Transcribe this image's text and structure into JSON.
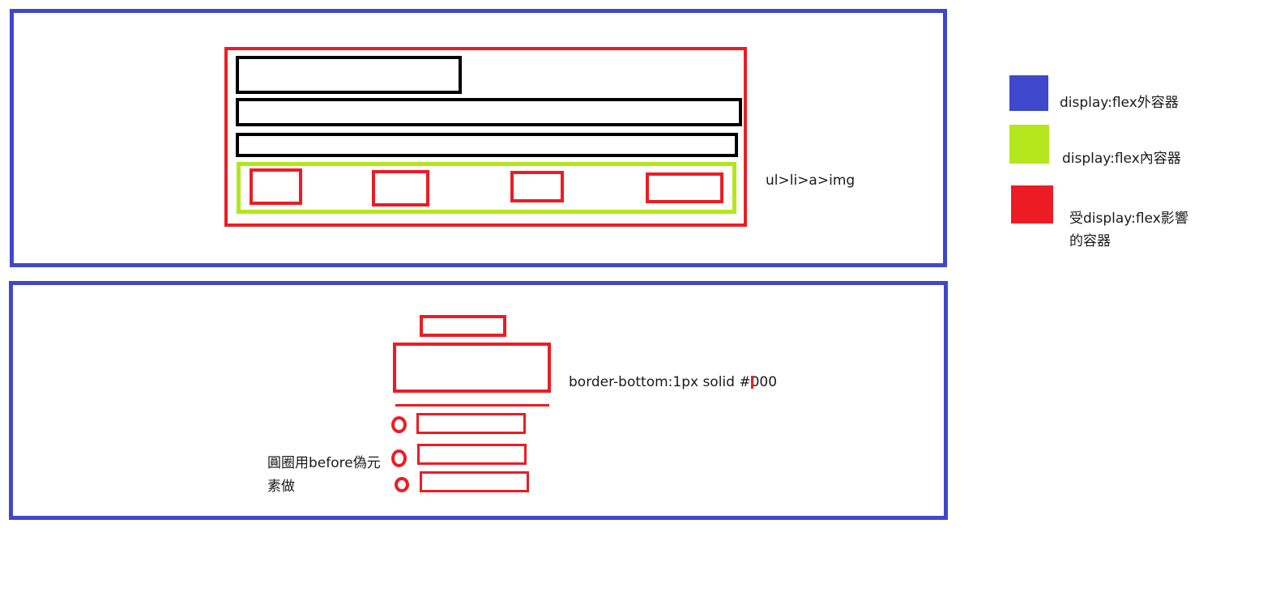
{
  "top_annotation": "ul>li>a>img",
  "bottom_annotation": "border-bottom:1px solid #000",
  "pseudo_note": "圓圈用before偽元素做",
  "legend": {
    "items": [
      {
        "label": "display:flex外容器",
        "color": "#3f48cc"
      },
      {
        "label": "display:flex內容器",
        "color": "#b5e61d"
      },
      {
        "label": "受display:flex影響的容器",
        "color": "#ed1c24"
      }
    ]
  },
  "colors": {
    "outer_flex": "#3f48cc",
    "inner_flex": "#b5e61d",
    "affected": "#ed1c24",
    "plain": "#000000"
  }
}
